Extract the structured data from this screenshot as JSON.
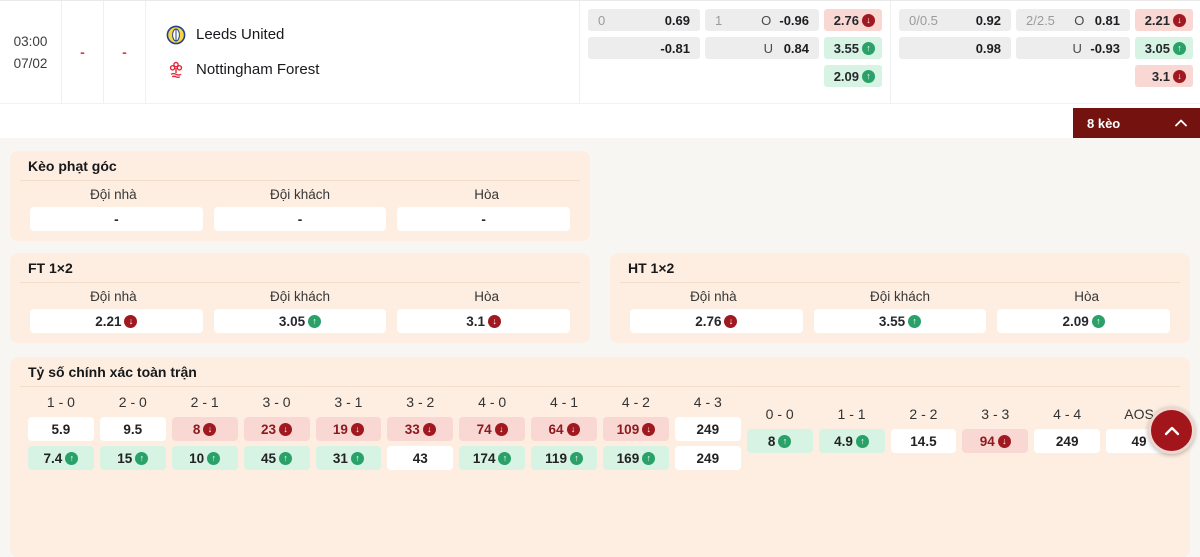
{
  "header": {
    "time": "03:00",
    "date": "07/02",
    "score_home": "-",
    "score_away": "-",
    "home_team": "Leeds United",
    "away_team": "Nottingham Forest",
    "more_odds_label": "8 kèo",
    "odds_groups": [
      {
        "handicap": {
          "line": "0",
          "home": "0.69",
          "away": "-0.81"
        },
        "over_under": {
          "line": "1",
          "over_label": "O",
          "over": "-0.96",
          "under_label": "U",
          "under": "0.84"
        },
        "one_x_two": [
          {
            "value": "2.76",
            "trend": "down"
          },
          {
            "value": "3.55",
            "trend": "up"
          },
          {
            "value": "2.09",
            "trend": "up"
          }
        ]
      },
      {
        "handicap": {
          "line": "0/0.5",
          "home": "0.92",
          "away": "0.98"
        },
        "over_under": {
          "line": "2/2.5",
          "over_label": "O",
          "over": "0.81",
          "under_label": "U",
          "under": "-0.93"
        },
        "one_x_two": [
          {
            "value": "2.21",
            "trend": "down"
          },
          {
            "value": "3.05",
            "trend": "up"
          },
          {
            "value": "3.1",
            "trend": "down"
          }
        ]
      }
    ]
  },
  "corner_panel": {
    "title": "Kèo phạt góc",
    "headers": [
      "Đội nhà",
      "Đội khách",
      "Hòa"
    ],
    "values": [
      "-",
      "-",
      "-"
    ]
  },
  "ft_panel": {
    "title": "FT 1×2",
    "headers": [
      "Đội nhà",
      "Đội khách",
      "Hòa"
    ],
    "odds": [
      {
        "value": "2.21",
        "trend": "down"
      },
      {
        "value": "3.05",
        "trend": "up"
      },
      {
        "value": "3.1",
        "trend": "down"
      }
    ]
  },
  "ht_panel": {
    "title": "HT 1×2",
    "headers": [
      "Đội nhà",
      "Đội khách",
      "Hòa"
    ],
    "odds": [
      {
        "value": "2.76",
        "trend": "down"
      },
      {
        "value": "3.55",
        "trend": "up"
      },
      {
        "value": "2.09",
        "trend": "up"
      }
    ]
  },
  "score_panel": {
    "title": "Tỷ số chính xác toàn trận",
    "main_columns": [
      {
        "label": "1 - 0",
        "top": {
          "value": "5.9",
          "trend": "none"
        },
        "bottom": {
          "value": "7.4",
          "trend": "up"
        }
      },
      {
        "label": "2 - 0",
        "top": {
          "value": "9.5",
          "trend": "none"
        },
        "bottom": {
          "value": "15",
          "trend": "up"
        }
      },
      {
        "label": "2 - 1",
        "top": {
          "value": "8",
          "trend": "down"
        },
        "bottom": {
          "value": "10",
          "trend": "up"
        }
      },
      {
        "label": "3 - 0",
        "top": {
          "value": "23",
          "trend": "down"
        },
        "bottom": {
          "value": "45",
          "trend": "up"
        }
      },
      {
        "label": "3 - 1",
        "top": {
          "value": "19",
          "trend": "down"
        },
        "bottom": {
          "value": "31",
          "trend": "up"
        }
      },
      {
        "label": "3 - 2",
        "top": {
          "value": "33",
          "trend": "down"
        },
        "bottom": {
          "value": "43",
          "trend": "none"
        }
      },
      {
        "label": "4 - 0",
        "top": {
          "value": "74",
          "trend": "down"
        },
        "bottom": {
          "value": "174",
          "trend": "up"
        }
      },
      {
        "label": "4 - 1",
        "top": {
          "value": "64",
          "trend": "down"
        },
        "bottom": {
          "value": "119",
          "trend": "up"
        }
      },
      {
        "label": "4 - 2",
        "top": {
          "value": "109",
          "trend": "down"
        },
        "bottom": {
          "value": "169",
          "trend": "up"
        }
      },
      {
        "label": "4 - 3",
        "top": {
          "value": "249",
          "trend": "none"
        },
        "bottom": {
          "value": "249",
          "trend": "none"
        }
      }
    ],
    "draw_columns": [
      {
        "label": "0 - 0",
        "value": "8",
        "trend": "up"
      },
      {
        "label": "1 - 1",
        "value": "4.9",
        "trend": "up"
      },
      {
        "label": "2 - 2",
        "value": "14.5",
        "trend": "none"
      },
      {
        "label": "3 - 3",
        "value": "94",
        "trend": "down"
      },
      {
        "label": "4 - 4",
        "value": "249",
        "trend": "none"
      },
      {
        "label": "AOS",
        "value": "49",
        "trend": "none"
      }
    ]
  },
  "icons": {
    "up_arrow": "↑",
    "down_arrow": "↓"
  },
  "colors": {
    "up_green": "#2aa169",
    "down_red": "#a01820",
    "pink_cell": "#f9d8d4",
    "mint_cell": "#d6f3e3",
    "panel_peach": "#fdeee1",
    "maroon_bar": "#73120f"
  }
}
